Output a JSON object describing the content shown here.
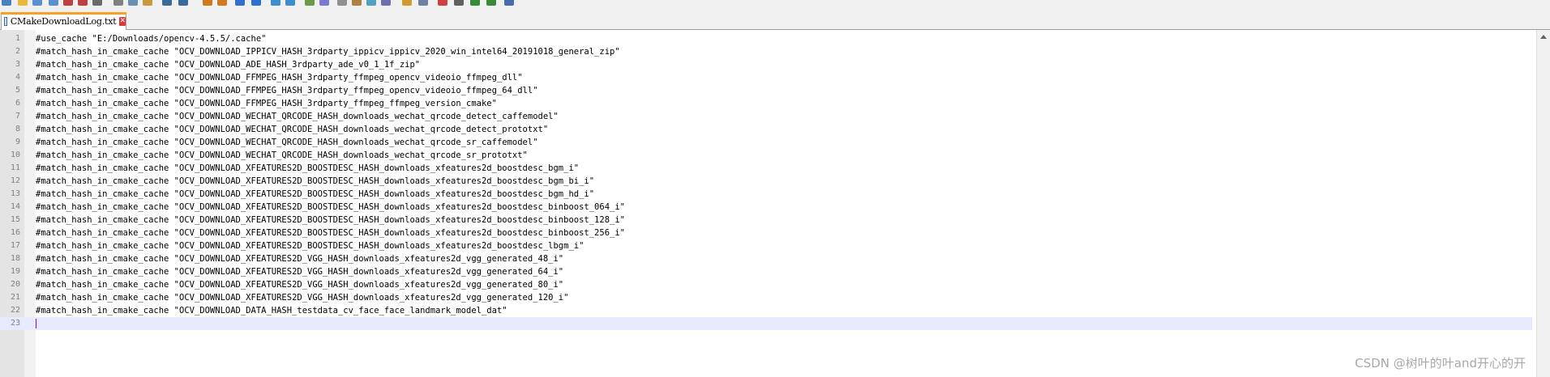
{
  "toolbar": {
    "icons": [
      "new-file-icon",
      "open-folder-icon",
      "save-icon",
      "save-all-icon",
      "close-icon",
      "close-all-icon",
      "print-icon",
      "cut-icon",
      "copy-icon",
      "paste-icon",
      "undo-icon",
      "redo-icon",
      "find-icon",
      "replace-icon",
      "zoom-in-icon",
      "zoom-out-icon",
      "sync-v-icon",
      "sync-h-icon",
      "word-wrap-icon",
      "all-chars-icon",
      "indent-guide-icon",
      "udl-icon",
      "doc-map-icon",
      "function-list-icon",
      "folder-workspace-icon",
      "monitor-icon",
      "record-icon",
      "stop-icon",
      "play-icon",
      "play-multiple-icon",
      "save-macro-icon"
    ]
  },
  "tab": {
    "label": "CMakeDownloadLog.txt",
    "close": "✕"
  },
  "editor": {
    "lines": [
      "#use_cache \"E:/Downloads/opencv-4.5.5/.cache\"",
      "#match_hash_in_cmake_cache \"OCV_DOWNLOAD_IPPICV_HASH_3rdparty_ippicv_ippicv_2020_win_intel64_20191018_general_zip\"",
      "#match_hash_in_cmake_cache \"OCV_DOWNLOAD_ADE_HASH_3rdparty_ade_v0_1_1f_zip\"",
      "#match_hash_in_cmake_cache \"OCV_DOWNLOAD_FFMPEG_HASH_3rdparty_ffmpeg_opencv_videoio_ffmpeg_dll\"",
      "#match_hash_in_cmake_cache \"OCV_DOWNLOAD_FFMPEG_HASH_3rdparty_ffmpeg_opencv_videoio_ffmpeg_64_dll\"",
      "#match_hash_in_cmake_cache \"OCV_DOWNLOAD_FFMPEG_HASH_3rdparty_ffmpeg_ffmpeg_version_cmake\"",
      "#match_hash_in_cmake_cache \"OCV_DOWNLOAD_WECHAT_QRCODE_HASH_downloads_wechat_qrcode_detect_caffemodel\"",
      "#match_hash_in_cmake_cache \"OCV_DOWNLOAD_WECHAT_QRCODE_HASH_downloads_wechat_qrcode_detect_prototxt\"",
      "#match_hash_in_cmake_cache \"OCV_DOWNLOAD_WECHAT_QRCODE_HASH_downloads_wechat_qrcode_sr_caffemodel\"",
      "#match_hash_in_cmake_cache \"OCV_DOWNLOAD_WECHAT_QRCODE_HASH_downloads_wechat_qrcode_sr_prototxt\"",
      "#match_hash_in_cmake_cache \"OCV_DOWNLOAD_XFEATURES2D_BOOSTDESC_HASH_downloads_xfeatures2d_boostdesc_bgm_i\"",
      "#match_hash_in_cmake_cache \"OCV_DOWNLOAD_XFEATURES2D_BOOSTDESC_HASH_downloads_xfeatures2d_boostdesc_bgm_bi_i\"",
      "#match_hash_in_cmake_cache \"OCV_DOWNLOAD_XFEATURES2D_BOOSTDESC_HASH_downloads_xfeatures2d_boostdesc_bgm_hd_i\"",
      "#match_hash_in_cmake_cache \"OCV_DOWNLOAD_XFEATURES2D_BOOSTDESC_HASH_downloads_xfeatures2d_boostdesc_binboost_064_i\"",
      "#match_hash_in_cmake_cache \"OCV_DOWNLOAD_XFEATURES2D_BOOSTDESC_HASH_downloads_xfeatures2d_boostdesc_binboost_128_i\"",
      "#match_hash_in_cmake_cache \"OCV_DOWNLOAD_XFEATURES2D_BOOSTDESC_HASH_downloads_xfeatures2d_boostdesc_binboost_256_i\"",
      "#match_hash_in_cmake_cache \"OCV_DOWNLOAD_XFEATURES2D_BOOSTDESC_HASH_downloads_xfeatures2d_boostdesc_lbgm_i\"",
      "#match_hash_in_cmake_cache \"OCV_DOWNLOAD_XFEATURES2D_VGG_HASH_downloads_xfeatures2d_vgg_generated_48_i\"",
      "#match_hash_in_cmake_cache \"OCV_DOWNLOAD_XFEATURES2D_VGG_HASH_downloads_xfeatures2d_vgg_generated_64_i\"",
      "#match_hash_in_cmake_cache \"OCV_DOWNLOAD_XFEATURES2D_VGG_HASH_downloads_xfeatures2d_vgg_generated_80_i\"",
      "#match_hash_in_cmake_cache \"OCV_DOWNLOAD_XFEATURES2D_VGG_HASH_downloads_xfeatures2d_vgg_generated_120_i\"",
      "#match_hash_in_cmake_cache \"OCV_DOWNLOAD_DATA_HASH_testdata_cv_face_face_landmark_model_dat\"",
      ""
    ],
    "line_numbers": [
      "1",
      "2",
      "3",
      "4",
      "5",
      "6",
      "7",
      "8",
      "9",
      "10",
      "11",
      "12",
      "13",
      "14",
      "15",
      "16",
      "17",
      "18",
      "19",
      "20",
      "21",
      "22",
      "23"
    ],
    "current_line": 23
  },
  "watermark": "CSDN @树叶的叶and开心的开",
  "colors": {
    "tab_accent": "#f9a024",
    "current_line_bg": "#e8e8ff",
    "caret": "#8000ff",
    "gutter_bg": "#e4e4e4",
    "line_number": "#808080"
  }
}
